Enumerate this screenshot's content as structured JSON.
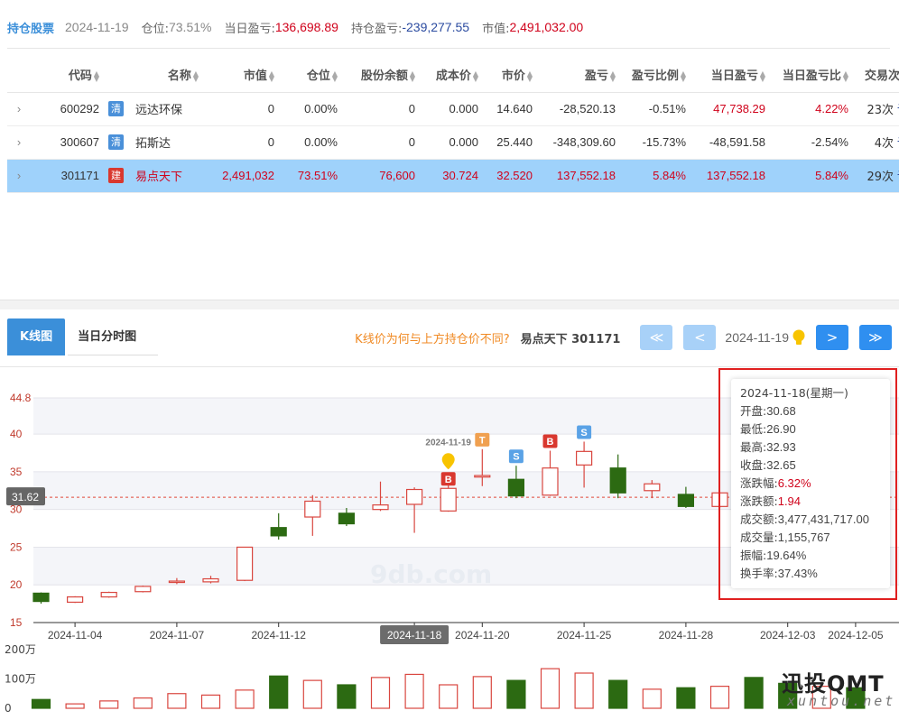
{
  "summary": {
    "title": "持仓股票",
    "date": "2024-11-19",
    "position_label": "仓位:",
    "position_value": "73.51%",
    "daily_pl_label": "当日盈亏:",
    "daily_pl_value": "136,698.89",
    "hold_pl_label": "持仓盈亏:",
    "hold_pl_value": "-239,277.55",
    "mktval_label": "市值:",
    "mktval_value": "2,491,032.00"
  },
  "table": {
    "columns": [
      "代码",
      "名称",
      "市值",
      "仓位",
      "股份余额",
      "成本价",
      "市价",
      "盈亏",
      "盈亏比例",
      "当日盈亏",
      "当日盈亏比",
      "交易次数"
    ],
    "rows": [
      {
        "code": "600292",
        "badge": "清",
        "badge_type": "clear",
        "name": "远达环保",
        "mktval": "0",
        "position": "0.00%",
        "shares": "0",
        "cost": "0.000",
        "price": "14.640",
        "pl": "-28,520.13",
        "pl_ratio": "-0.51%",
        "daily_pl": "47,738.29",
        "daily_ratio": "4.22%",
        "trades": "23次",
        "detail": "详情",
        "selected": false
      },
      {
        "code": "300607",
        "badge": "清",
        "badge_type": "clear",
        "name": "拓斯达",
        "mktval": "0",
        "position": "0.00%",
        "shares": "0",
        "cost": "0.000",
        "price": "25.440",
        "pl": "-348,309.60",
        "pl_ratio": "-15.73%",
        "daily_pl": "-48,591.58",
        "daily_ratio": "-2.54%",
        "trades": "4次",
        "detail": "详情",
        "selected": false
      },
      {
        "code": "301171",
        "badge": "建",
        "badge_type": "build",
        "name": "易点天下",
        "mktval": "2,491,032",
        "position": "73.51%",
        "shares": "76,600",
        "cost": "30.724",
        "price": "32.520",
        "pl": "137,552.18",
        "pl_ratio": "5.84%",
        "daily_pl": "137,552.18",
        "daily_ratio": "5.84%",
        "trades": "29次",
        "detail": "详情",
        "selected": true
      }
    ]
  },
  "chart_panel": {
    "tabs": [
      "K线图",
      "当日分时图"
    ],
    "question": "K线价为何与上方持仓价不同?",
    "stock": "易点天下 301171",
    "current_date": "2024-11-19",
    "first_btn": "≪",
    "prev_btn": "<",
    "next_btn": ">",
    "last_btn": "≫"
  },
  "chart_data": {
    "type": "candlestick",
    "y_ticks": [
      "44.8",
      "40",
      "35",
      "30",
      "25",
      "20",
      "15"
    ],
    "ylim": [
      15,
      44.8
    ],
    "ref_price": 31.62,
    "ref_price_label": "31.62",
    "x_labels": [
      "2024-11-04",
      "2024-11-07",
      "2024-11-12",
      "2024-11-18",
      "2024-11-20",
      "2024-11-25",
      "2024-11-28",
      "2024-12-03",
      "2024-12-05"
    ],
    "hover_label": "2024-11-18",
    "vol_ticks": [
      "200万",
      "100万",
      "0"
    ],
    "vol_max": 2000000,
    "candles": [
      {
        "o": 18.9,
        "c": 17.8,
        "h": 19.0,
        "l": 17.5,
        "v": 300000
      },
      {
        "o": 17.7,
        "c": 18.4,
        "h": 18.5,
        "l": 17.6,
        "v": 150000
      },
      {
        "o": 18.4,
        "c": 19.0,
        "h": 19.1,
        "l": 18.3,
        "v": 250000
      },
      {
        "o": 19.1,
        "c": 19.8,
        "h": 19.9,
        "l": 19.0,
        "v": 350000
      },
      {
        "o": 20.4,
        "c": 20.5,
        "h": 20.9,
        "l": 20.1,
        "v": 500000
      },
      {
        "o": 20.4,
        "c": 20.8,
        "h": 21.2,
        "l": 20.2,
        "v": 450000
      },
      {
        "o": 20.6,
        "c": 25.0,
        "h": 25.0,
        "l": 20.5,
        "v": 620000
      },
      {
        "o": 27.6,
        "c": 26.5,
        "h": 29.5,
        "l": 26.0,
        "v": 1100000
      },
      {
        "o": 29.0,
        "c": 31.1,
        "h": 31.9,
        "l": 26.5,
        "v": 950000
      },
      {
        "o": 29.5,
        "c": 28.1,
        "h": 30.2,
        "l": 27.8,
        "v": 800000
      },
      {
        "o": 30.0,
        "c": 30.6,
        "h": 33.7,
        "l": 29.8,
        "v": 1050000
      },
      {
        "o": 30.68,
        "c": 32.65,
        "h": 32.93,
        "l": 26.9,
        "v": 1155767
      },
      {
        "o": 29.8,
        "c": 32.8,
        "h": 33.4,
        "l": 29.7,
        "v": 800000
      },
      {
        "o": 34.3,
        "c": 34.5,
        "h": 38.0,
        "l": 33.1,
        "v": 1080000
      },
      {
        "o": 34.0,
        "c": 31.8,
        "h": 35.8,
        "l": 31.5,
        "v": 950000
      },
      {
        "o": 31.9,
        "c": 35.5,
        "h": 37.8,
        "l": 31.8,
        "v": 1350000
      },
      {
        "o": 35.9,
        "c": 37.7,
        "h": 39.0,
        "l": 32.9,
        "v": 1200000
      },
      {
        "o": 35.5,
        "c": 32.2,
        "h": 37.3,
        "l": 31.5,
        "v": 950000
      },
      {
        "o": 32.5,
        "c": 33.4,
        "h": 33.9,
        "l": 31.5,
        "v": 650000
      },
      {
        "o": 32.0,
        "c": 30.4,
        "h": 33.0,
        "l": 30.2,
        "v": 700000
      },
      {
        "o": 30.4,
        "c": 32.2,
        "h": 32.3,
        "l": 30.2,
        "v": 750000
      },
      {
        "o": 32.0,
        "c": 31.4,
        "h": 32.2,
        "l": 31.0,
        "v": 1050000
      },
      {
        "o": 31.4,
        "c": 30.8,
        "h": 31.5,
        "l": 30.6,
        "v": 850000
      },
      {
        "o": 30.8,
        "c": 31.0,
        "h": 31.2,
        "l": 30.6,
        "v": 750000
      },
      {
        "o": 31.0,
        "c": 30.6,
        "h": 31.2,
        "l": 30.4,
        "v": 700000
      }
    ],
    "markers": [
      {
        "index": 12,
        "label": "B",
        "kind": "buy",
        "date_label": "2024-11-19",
        "pin": true
      },
      {
        "index": 13,
        "label": "T",
        "kind": "t"
      },
      {
        "index": 14,
        "label": "S",
        "kind": "sell"
      },
      {
        "index": 15,
        "label": "B",
        "kind": "buy"
      },
      {
        "index": 16,
        "label": "S",
        "kind": "sell"
      }
    ],
    "watermark": "9db.com"
  },
  "tooltip": {
    "date": "2024-11-18(星期一)",
    "rows": [
      {
        "label": "开盘:",
        "value": "30.68",
        "red": false
      },
      {
        "label": "最低:",
        "value": "26.90",
        "red": false
      },
      {
        "label": "最高:",
        "value": "32.93",
        "red": false
      },
      {
        "label": "收盘:",
        "value": "32.65",
        "red": false
      },
      {
        "label": "涨跌幅:",
        "value": "6.32%",
        "red": true
      },
      {
        "label": "涨跌额:",
        "value": "1.94",
        "red": true
      },
      {
        "label": "成交额:",
        "value": "3,477,431,717.00",
        "red": false
      },
      {
        "label": "成交量:",
        "value": "1,155,767",
        "red": false
      },
      {
        "label": "振幅:",
        "value": "19.64%",
        "red": false
      },
      {
        "label": "换手率:",
        "value": "37.43%",
        "red": false
      }
    ]
  },
  "watermark": {
    "main": "迅投QMT",
    "sub": "xuntou.net"
  },
  "colors": {
    "up": "#d9463f",
    "down": "#2c6a12",
    "accent": "#3b8fd9",
    "ref_line": "#e04a3a"
  }
}
